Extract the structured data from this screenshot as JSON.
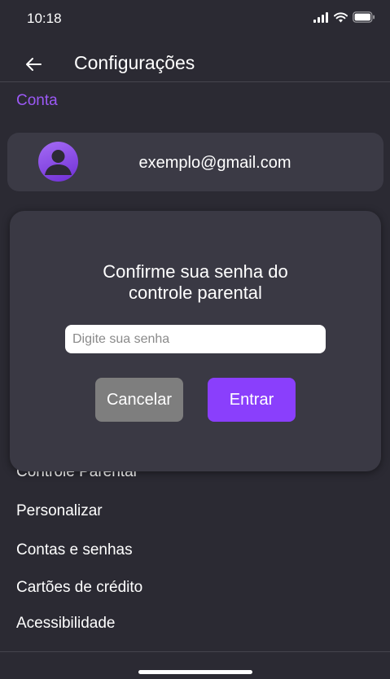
{
  "status_bar": {
    "time": "10:18",
    "icons": [
      "signal-icon",
      "wifi-icon",
      "battery-icon"
    ]
  },
  "header": {
    "back_icon": "arrow-left-icon",
    "title": "Configurações"
  },
  "account_section": {
    "label": "Conta",
    "email": "exemplo@gmail.com",
    "avatar_icon": "user-avatar-icon"
  },
  "menu": {
    "items": [
      {
        "label": "Controle Parental"
      },
      {
        "label": "Personalizar"
      },
      {
        "label": "Contas e senhas"
      },
      {
        "label": "Cartões de crédito"
      },
      {
        "label": "Acessibilidade"
      }
    ]
  },
  "modal": {
    "title_line1": "Confirme sua senha do",
    "title_line2": "controle parental",
    "password_placeholder": "Digite sua senha",
    "password_value": "",
    "cancel_label": "Cancelar",
    "enter_label": "Entrar"
  },
  "colors": {
    "background": "#2b2a33",
    "card": "#3b3a45",
    "accent": "#8a3ffc",
    "section_label": "#9b59f5",
    "cancel": "#7e7e7e"
  }
}
